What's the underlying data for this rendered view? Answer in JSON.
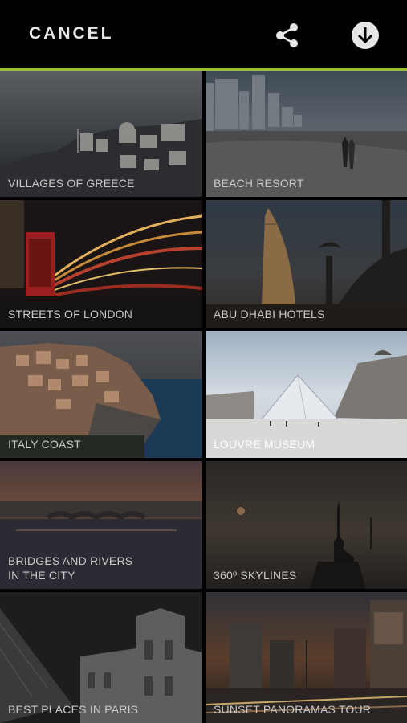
{
  "header": {
    "cancel_label": "CANCEL",
    "share_icon": "share-icon",
    "download_icon": "download-icon"
  },
  "colors": {
    "accent": "#9bbf3a",
    "background": "#000000"
  },
  "tiles": [
    {
      "label": "VILLAGES OF GREECE"
    },
    {
      "label": "BEACH RESORT"
    },
    {
      "label": "STREETS OF LONDON"
    },
    {
      "label": "ABU DHABI HOTELS"
    },
    {
      "label": "ITALY COAST"
    },
    {
      "label": "LOUVRE MUSEUM"
    },
    {
      "label_line1": "BRIDGES AND RIVERS",
      "label_line2": "IN THE CITY"
    },
    {
      "label": "360º SKYLINES"
    },
    {
      "label": "BEST PLACES IN PARIS"
    },
    {
      "label": "SUNSET PANORAMAS TOUR"
    }
  ]
}
